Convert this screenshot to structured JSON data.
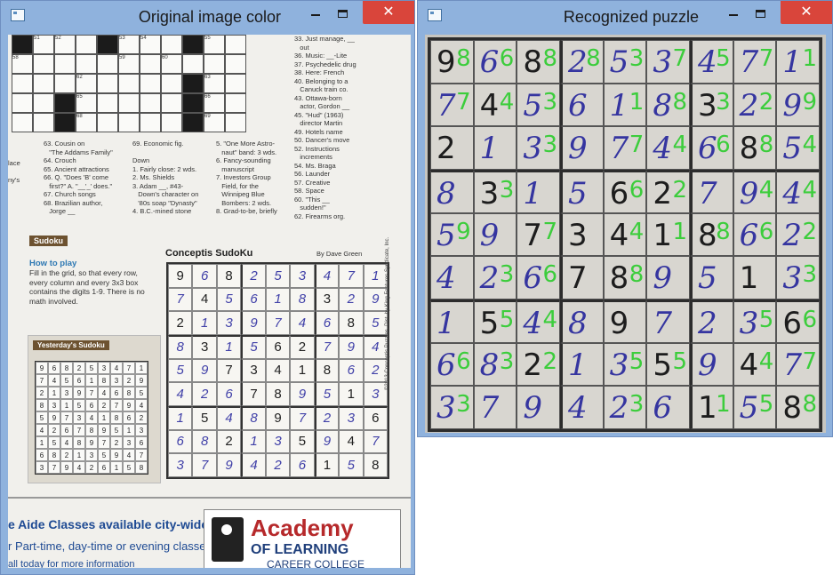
{
  "left_window": {
    "title": "Original image color"
  },
  "right_window": {
    "title": "Recognized puzzle"
  },
  "controls": {
    "minimize": "—",
    "maximize": "□",
    "close": "✕"
  },
  "accent_colors": {
    "title_bar": "#8fb2dd",
    "close_button": "#d9453b",
    "recognized_digit": "#3ccd3c",
    "handwritten_ink": "#3535a0"
  },
  "newspaper": {
    "crossword_numbers": [
      "51",
      "52",
      "53",
      "54",
      "55",
      "58",
      "59",
      "60",
      "62",
      "63",
      "65",
      "66",
      "68",
      "69"
    ],
    "clues_col1": "63. Cousin on\n   \"The Addams Family\"\n64. Crouch\n65. Ancient attractions\n66. Q. \"Does 'B' come\n   first?\" A. \"__'_' does.\"\n67. Church songs\n68. Brazilian author,\n   Jorge __",
    "clues_col2": "69. Economic fig.\n\nDown\n1. Fairly close: 2 wds.\n2. Ms. Shields\n3. Adam __, #43-\n   Down's character on\n   '80s soap \"Dynasty\"\n4. B.C.-mined stone",
    "clues_col3": "5. \"One More Astro-\n   naut\" band: 3 wds.\n6. Fancy-sounding\n   manuscript\n7. Investors Group\n   Field, for the\n   Winnipeg Blue\n   Bombers: 2 wds.\n8. Grad-to-be, briefly",
    "clues_col4": "33. Just manage, __\n   out\n36. Music: __-Lite\n37. Psychedelic drug\n38. Here: French\n40. Belonging to a\n   Canuck train co.\n43. Ottawa-born\n   actor, Gordon __\n45. \"Hud\" (1963)\n   director Martin\n49. Hotels name\n50. Dancer's move\n52. Instructions\n   increments\n54. Ms. Braga\n56. Launder\n57. Creative\n58. Space\n60. \"This __\n   sudden!\"\n62. Firearms org.",
    "clues_edge": "lace\n\nny's",
    "sudoku_tag": "Sudoku",
    "howto_title": "How to play",
    "howto_text": "Fill in the grid, so that every row, every column and every 3x3 box contains the digits 1-9. There is no math involved.",
    "yesterday_tag": "Yesterday's Sudoku",
    "yesterday_grid": [
      [
        "9",
        "6",
        "8",
        "2",
        "5",
        "3",
        "4",
        "7",
        "1"
      ],
      [
        "7",
        "4",
        "5",
        "6",
        "1",
        "8",
        "3",
        "2",
        "9"
      ],
      [
        "2",
        "1",
        "3",
        "9",
        "7",
        "4",
        "6",
        "8",
        "5"
      ],
      [
        "8",
        "3",
        "1",
        "5",
        "6",
        "2",
        "7",
        "9",
        "4"
      ],
      [
        "5",
        "9",
        "7",
        "3",
        "4",
        "1",
        "8",
        "6",
        "2"
      ],
      [
        "4",
        "2",
        "6",
        "7",
        "8",
        "9",
        "5",
        "1",
        "3"
      ],
      [
        "1",
        "5",
        "4",
        "8",
        "9",
        "7",
        "2",
        "3",
        "6"
      ],
      [
        "6",
        "8",
        "2",
        "1",
        "3",
        "5",
        "9",
        "4",
        "7"
      ],
      [
        "3",
        "7",
        "9",
        "4",
        "2",
        "6",
        "1",
        "5",
        "8"
      ]
    ],
    "conceptis_title": "Conceptis SudoKu",
    "byline": "By Dave Green",
    "credit": "©2013 Conceptis Puzzles. Dist. by King Features Syndicate, Inc.",
    "ad_line1": "e Aide Classes available city-wide.",
    "ad_line2": "r Part-time, day-time or evening classes.",
    "ad_line3": "all today for more information",
    "ad_name": "Academy",
    "ad_sub1": "OF LEARNING",
    "ad_sub2": "CAREER COLLEGE"
  },
  "puzzle": {
    "original_digits": [
      [
        "9",
        "6",
        "8",
        "2",
        "5",
        "3",
        "4",
        "7",
        "1"
      ],
      [
        "7",
        "4",
        "5",
        "6",
        "1",
        "8",
        "3",
        "2",
        "9"
      ],
      [
        "2",
        "1",
        "3",
        "9",
        "7",
        "4",
        "6",
        "8",
        "5"
      ],
      [
        "8",
        "3",
        "1",
        "5",
        "6",
        "2",
        "7",
        "9",
        "4"
      ],
      [
        "5",
        "9",
        "7",
        "3",
        "4",
        "1",
        "8",
        "6",
        "2"
      ],
      [
        "4",
        "2",
        "6",
        "7",
        "8",
        "9",
        "5",
        "1",
        "3"
      ],
      [
        "1",
        "5",
        "4",
        "8",
        "9",
        "7",
        "2",
        "3",
        "6"
      ],
      [
        "6",
        "8",
        "2",
        "1",
        "3",
        "5",
        "9",
        "4",
        "7"
      ],
      [
        "3",
        "7",
        "9",
        "4",
        "2",
        "6",
        "1",
        "5",
        "8"
      ]
    ],
    "handwritten": [
      [
        false,
        true,
        false,
        true,
        true,
        true,
        true,
        true,
        true
      ],
      [
        true,
        false,
        true,
        true,
        true,
        true,
        false,
        true,
        true
      ],
      [
        false,
        true,
        true,
        true,
        true,
        true,
        true,
        false,
        true
      ],
      [
        true,
        false,
        true,
        true,
        false,
        false,
        true,
        true,
        true
      ],
      [
        true,
        true,
        false,
        false,
        false,
        false,
        false,
        true,
        true
      ],
      [
        true,
        true,
        true,
        false,
        false,
        true,
        true,
        false,
        true
      ],
      [
        true,
        false,
        true,
        true,
        false,
        true,
        true,
        true,
        false
      ],
      [
        true,
        true,
        false,
        true,
        true,
        false,
        true,
        false,
        true
      ],
      [
        true,
        true,
        true,
        true,
        true,
        true,
        false,
        true,
        false
      ]
    ],
    "recognized_digits": [
      [
        "8",
        "6",
        "8",
        "8",
        "3",
        "7",
        "5",
        "7",
        "1"
      ],
      [
        "7",
        "4",
        "3",
        "",
        "1",
        "8",
        "3",
        "2",
        "9"
      ],
      [
        "",
        "",
        "3",
        "",
        "7",
        "4",
        "6",
        "8",
        "4"
      ],
      [
        "",
        "3",
        "",
        "",
        "6",
        "2",
        "",
        "4",
        "4"
      ],
      [
        "9",
        "",
        "7",
        "",
        "4",
        "1",
        "8",
        "6",
        "2"
      ],
      [
        "",
        "3",
        "6",
        "",
        "8",
        "",
        "",
        "",
        "3"
      ],
      [
        "",
        "5",
        "4",
        "",
        "",
        "",
        "",
        "5",
        "6"
      ],
      [
        "6",
        "3",
        "2",
        "",
        "5",
        "5",
        "",
        "4",
        "7"
      ],
      [
        "3",
        "",
        "",
        "",
        "3",
        "",
        "1",
        "5",
        "8"
      ]
    ]
  }
}
